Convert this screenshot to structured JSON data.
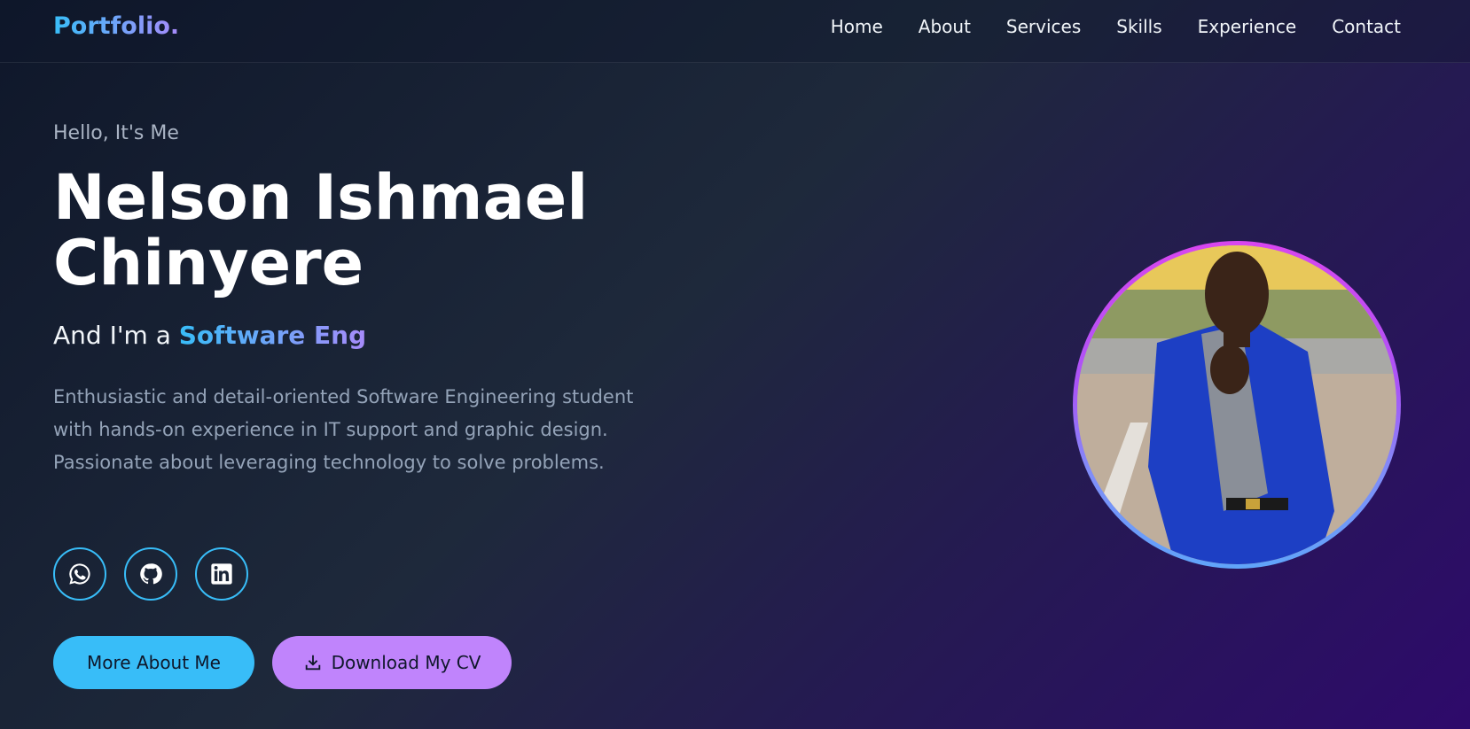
{
  "nav": {
    "logo": "Portfolio.",
    "links": [
      "Home",
      "About",
      "Services",
      "Skills",
      "Experience",
      "Contact"
    ]
  },
  "hero": {
    "greeting": "Hello, It's Me",
    "name": "Nelson Ishmael Chinyere",
    "role_prefix": "And I'm a ",
    "role_highlight": "Software Eng",
    "bio": "Enthusiastic and detail-oriented Software Engineering student with hands-on experience in IT support and graphic design. Passionate about leveraging technology to solve problems.",
    "socials": [
      {
        "icon": "whatsapp-icon"
      },
      {
        "icon": "github-icon"
      },
      {
        "icon": "linkedin-icon"
      }
    ],
    "primary_button": "More About Me",
    "secondary_button": "Download My CV"
  },
  "colors": {
    "accent_blue": "#38bdf8",
    "accent_purple": "#c084fc",
    "bg_start": "#0f172a",
    "bg_end": "#2e0a6b"
  }
}
